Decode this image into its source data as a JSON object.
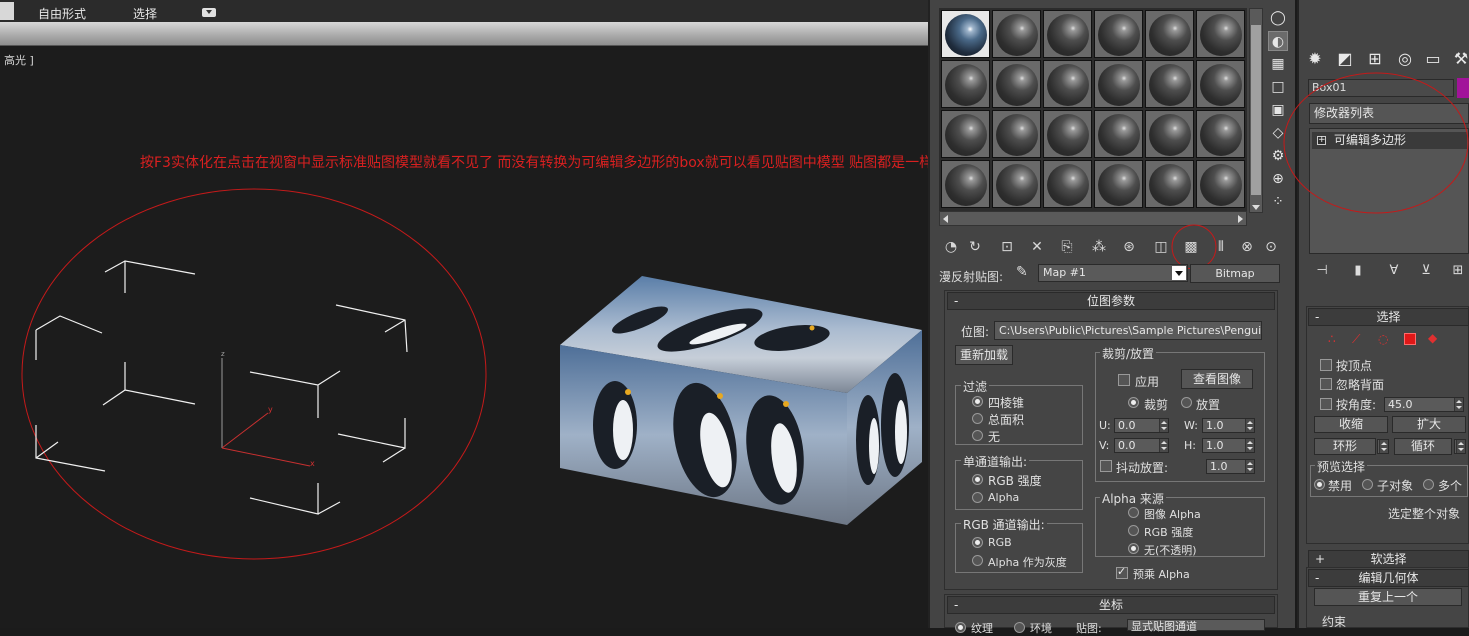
{
  "viewport": {
    "mode_label": "自由形式",
    "select_label": "选择",
    "view_label": "高光 ]",
    "annotation": "按F3实体化在点击在视窗中显示标准贴图模型就看不见了 而没有转换为可编辑多边形的box就可以看见贴图中模型 贴图都是一样的"
  },
  "material_editor": {
    "map_label": "漫反射贴图:",
    "map_name": "Map #1",
    "map_type": "Bitmap",
    "bitmap_params": {
      "title": "位图参数",
      "bitmap_label": "位图:",
      "bitmap_path": "C:\\Users\\Public\\Pictures\\Sample Pictures\\Penguins.jpg",
      "reload": "重新加载",
      "crop_group": "裁剪/放置",
      "apply": "应用",
      "view_image": "查看图像",
      "crop": "裁剪",
      "place": "放置",
      "u_label": "U:",
      "u_value": "0.0",
      "w_label": "W:",
      "w_value": "1.0",
      "v_label": "V:",
      "v_value": "0.0",
      "h_label": "H:",
      "h_value": "1.0",
      "jitter": "抖动放置:",
      "jitter_value": "1.0",
      "filter_group": "过滤",
      "filter_pyramid": "四棱锥",
      "filter_sat": "总面积",
      "filter_none": "无",
      "mono_group": "单通道输出:",
      "mono_rgb": "RGB 强度",
      "mono_alpha": "Alpha",
      "rgb_group": "RGB 通道输出:",
      "rgb_rgb": "RGB",
      "rgb_alpha": "Alpha 作为灰度",
      "alpha_group": "Alpha 来源",
      "alpha_image": "图像 Alpha",
      "alpha_rgb": "RGB 强度",
      "alpha_none": "无(不透明)",
      "premult": "预乘 Alpha"
    },
    "coords": {
      "title": "坐标",
      "texture": "纹理",
      "environ": "环境",
      "mapping": "贴图:",
      "channel": "显式贴图通道"
    }
  },
  "command_panel": {
    "object_name": "Box01",
    "object_color": "#a2139a",
    "modifier_list": "修改器列表",
    "stack_item": "可编辑多边形",
    "selection": {
      "title": "选择",
      "by_vertex": "按顶点",
      "ignore_backface": "忽略背面",
      "by_angle": "按角度:",
      "angle_value": "45.0",
      "shrink": "收缩",
      "grow": "扩大",
      "ring": "环形",
      "loop": "循环",
      "preview_group": "预览选择",
      "preview_off": "禁用",
      "preview_subobj": "子对象",
      "preview_multi": "多个",
      "select_whole": "选定整个对象"
    },
    "soft_selection": "软选择",
    "edit_geometry": {
      "title": "编辑几何体",
      "repeat_last": "重复上一个",
      "constraints": "约束"
    }
  },
  "colors": {
    "annotation_red": "#d92020",
    "viewport_bg": "#1c1c1c",
    "panel_bg": "#444444"
  }
}
